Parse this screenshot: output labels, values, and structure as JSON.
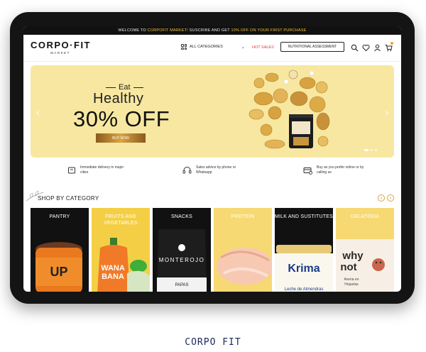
{
  "promo": {
    "text_pre": "WELCOME TO ",
    "brand": "CORPOFIT MARKET!",
    "text_mid": " SUSCRIBE AND GET ",
    "offer": "10% OFF ON YOUR FIRST PURCHASE"
  },
  "logo": {
    "main": "CORPO·FIT",
    "sub": "MARKET"
  },
  "nav": {
    "categories_label": "ALL CATEGORIES",
    "hot_sales_label": "HOT SALES",
    "nutritional_label": "NUTRITIONAL ASSESSMENT"
  },
  "hero": {
    "eat": "Eat",
    "healthy": "Healthy",
    "discount": "30% OFF",
    "cta": "BUY NOW",
    "prev": "‹",
    "next": "›"
  },
  "features": [
    {
      "icon": "delivery-box-icon",
      "text": "Immediate delivery in major cities"
    },
    {
      "icon": "support-headset-icon",
      "text": "Sales advice by phone or Whatsapp"
    },
    {
      "icon": "payment-card-icon",
      "text": "Buy as you prefer online or by calling us"
    }
  ],
  "categories": {
    "title": "SHOP BY CATEGORY",
    "prev": "‹",
    "next": "›",
    "items": [
      {
        "label": "PANTRY",
        "bg": "#111111"
      },
      {
        "label": "FRUITS AND VEGETABLES",
        "bg": "#f4cf45"
      },
      {
        "label": "SNACKS",
        "bg": "#111111"
      },
      {
        "label": "PROTEIN",
        "bg": "#f6d972"
      },
      {
        "label": "MILK AND SUSTITUTES",
        "bg": "#111111"
      },
      {
        "label": "GELATERIA",
        "bg": "#f6d972"
      }
    ]
  },
  "caption": "CORPO FIT",
  "colors": {
    "accent": "#f0c040",
    "hero_bg": "#f7e7a0",
    "hot": "#e53935"
  }
}
